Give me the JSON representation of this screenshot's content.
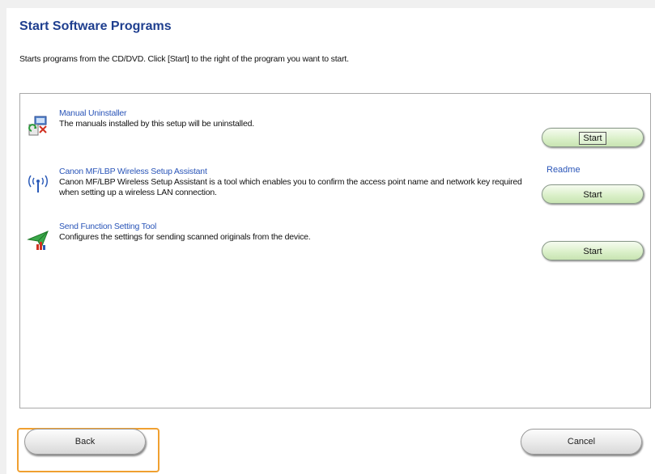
{
  "header": {
    "title": "Start Software Programs",
    "description": "Starts programs from the CD/DVD. Click [Start] to the right of the program you want to start."
  },
  "programs": [
    {
      "name": "Manual Uninstaller",
      "description": "The manuals installed by this setup will be uninstalled.",
      "icon": "uninstaller-icon",
      "start_label": "Start"
    },
    {
      "name": "Canon MF/LBP Wireless Setup Assistant",
      "description": "Canon MF/LBP Wireless Setup Assistant is a tool which enables you to confirm the access point name and network key required when setting up a wireless LAN connection.",
      "icon": "wireless-icon",
      "readme_label": "Readme",
      "start_label": "Start"
    },
    {
      "name": "Send Function Setting Tool",
      "description": "Configures the settings for sending scanned originals from the device.",
      "icon": "send-function-icon",
      "start_label": "Start"
    }
  ],
  "footer": {
    "back_label": "Back",
    "cancel_label": "Cancel"
  },
  "colors": {
    "title": "#1f3f8f",
    "link": "#2a55b8",
    "start_button": "#d9efc7",
    "highlight": "#f0a030"
  }
}
